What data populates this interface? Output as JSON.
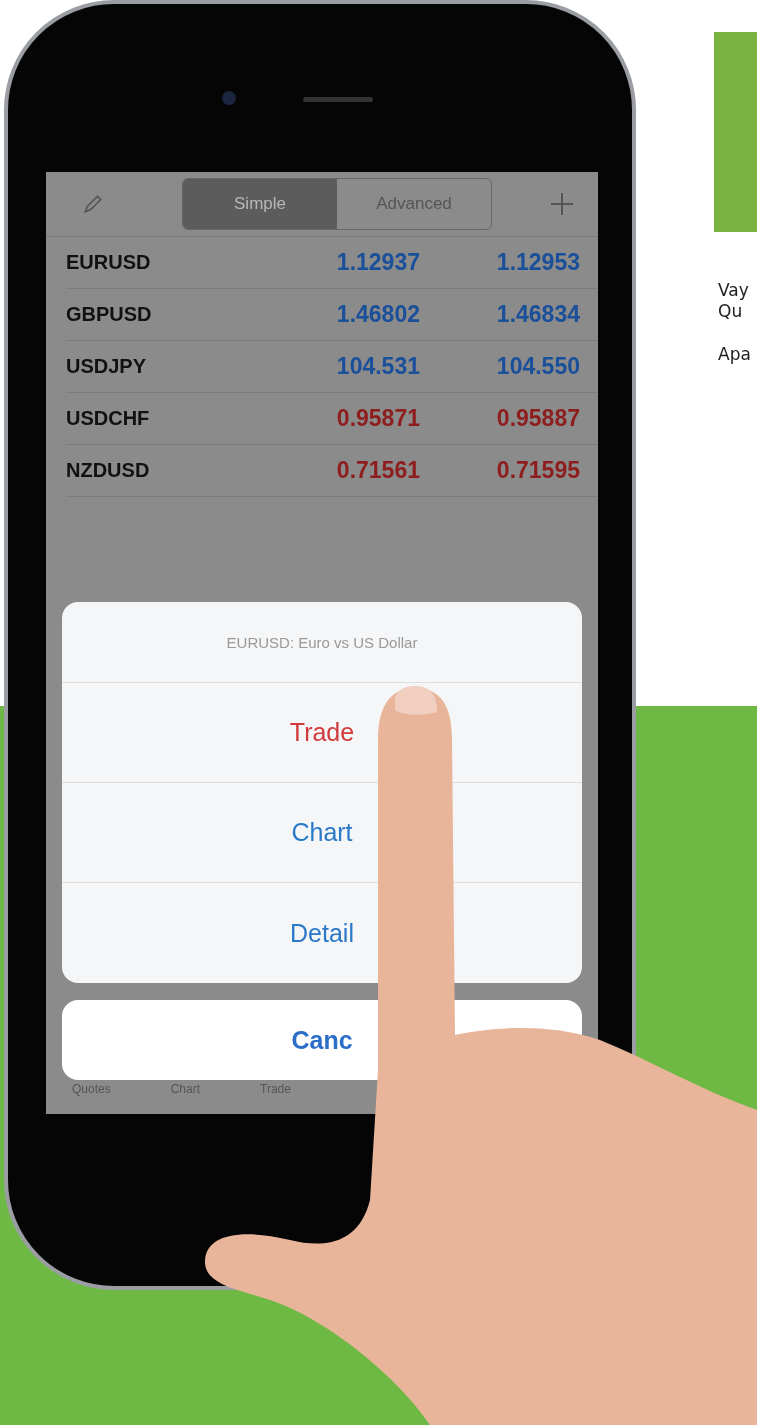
{
  "toolbar": {
    "segments": [
      {
        "label": "Simple",
        "selected": true
      },
      {
        "label": "Advanced",
        "selected": false
      }
    ]
  },
  "quotes": [
    {
      "symbol": "EURUSD",
      "bid": "1.12937",
      "ask": "1.12953",
      "color": "#1a4f9a"
    },
    {
      "symbol": "GBPUSD",
      "bid": "1.46802",
      "ask": "1.46834",
      "color": "#1a4f9a"
    },
    {
      "symbol": "USDJPY",
      "bid": "104.531",
      "ask": "104.550",
      "color": "#1a4f9a"
    },
    {
      "symbol": "USDCHF",
      "bid": "0.95871",
      "ask": "0.95887",
      "color": "#8e1e1e"
    },
    {
      "symbol": "NZDUSD",
      "bid": "0.71561",
      "ask": "0.71595",
      "color": "#8e1e1e"
    }
  ],
  "action_sheet": {
    "title": "EURUSD: Euro vs US Dollar",
    "actions": [
      {
        "label": "Trade",
        "kind": "primary"
      },
      {
        "label": "Chart",
        "kind": "normal"
      },
      {
        "label": "Detail",
        "kind": "normal"
      }
    ],
    "cancel": "Canc"
  },
  "tab_bar": [
    "Quotes",
    "Chart",
    "Trade"
  ],
  "side_text": {
    "lines": [
      "Vay",
      "Qu"
    ],
    "paragraph": "Apa"
  }
}
